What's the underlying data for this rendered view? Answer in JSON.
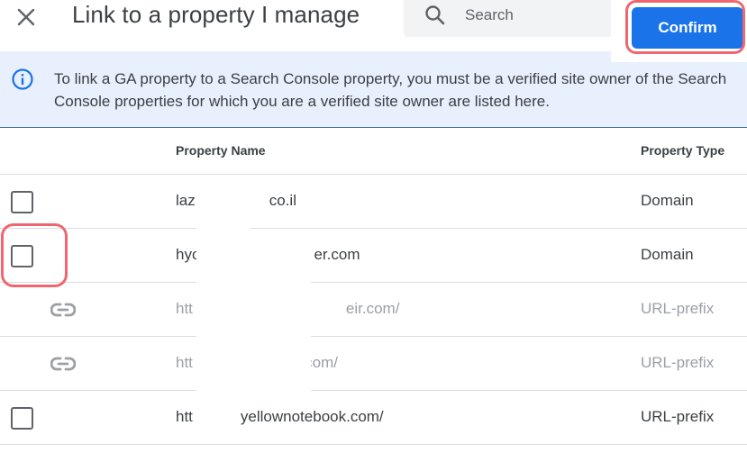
{
  "dialog": {
    "title": "Link to a property I manage",
    "close_icon": "close-icon"
  },
  "search": {
    "icon": "search-icon",
    "placeholder": "Search",
    "value": ""
  },
  "toolbar": {
    "confirm_label": "Confirm"
  },
  "banner": {
    "icon": "info-icon",
    "line1": "To link a GA property to a Search Console property, you must be a verified site owner of the Search",
    "line2": "Console properties for which you are a verified site owner are listed here."
  },
  "table": {
    "columns": [
      "Property Name",
      "Property Type"
    ],
    "rows": [
      {
        "control": "checkbox",
        "checked": false,
        "name_prefix": "laz",
        "name_suffix": "co.il",
        "type": "Domain",
        "enabled": true
      },
      {
        "control": "checkbox",
        "checked": false,
        "name_prefix": "hyc",
        "name_suffix": "er.com",
        "type": "Domain",
        "enabled": true
      },
      {
        "control": "link-icon",
        "name_prefix": "htt",
        "name_suffix": "eir.com/",
        "type": "URL-prefix",
        "enabled": false
      },
      {
        "control": "link-icon",
        "name_prefix": "htt",
        "name_suffix": "s.com/",
        "type": "URL-prefix",
        "enabled": false
      },
      {
        "control": "checkbox",
        "checked": false,
        "name_prefix": "htt",
        "name_suffix": "yellownotebook.com/",
        "type": "URL-prefix",
        "enabled": true
      }
    ]
  },
  "colors": {
    "accent": "#1a73e8",
    "highlight": "#ee6770",
    "banner_bg": "#e8f0fe"
  }
}
